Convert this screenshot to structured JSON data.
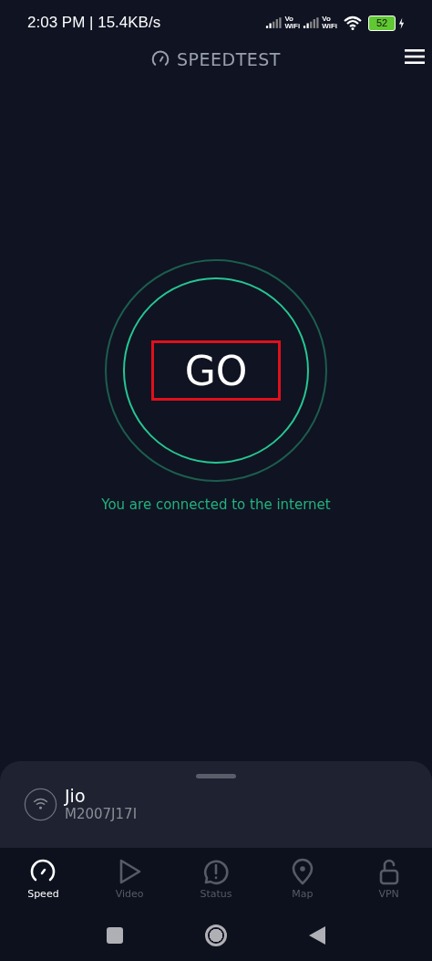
{
  "status_bar": {
    "time": "2:03 PM | 15.4KB/s",
    "sim_labels": [
      "Vo\nWiFi",
      "Vo\nWiFi"
    ],
    "battery": "52"
  },
  "header": {
    "title": "SPEEDTEST"
  },
  "go_button": {
    "label": "GO",
    "highlighted": true
  },
  "connection_message": "You are connected to the internet",
  "network_sheet": {
    "name": "Jio",
    "device": "M2007J17I"
  },
  "tabs": [
    {
      "kind": "speed",
      "label": "Speed",
      "selected": true
    },
    {
      "kind": "video",
      "label": "Video",
      "selected": false
    },
    {
      "kind": "status",
      "label": "Status",
      "selected": false
    },
    {
      "kind": "map",
      "label": "Map",
      "selected": false
    },
    {
      "kind": "vpn",
      "label": "VPN",
      "selected": false
    }
  ]
}
